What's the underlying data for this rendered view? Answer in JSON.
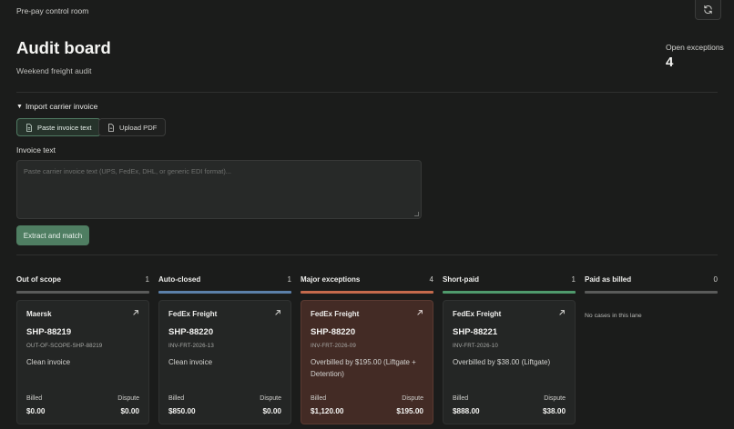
{
  "topbar": {
    "title": "Pre-pay control room",
    "refresh_icon": "refresh-icon"
  },
  "header": {
    "title": "Audit board",
    "subtitle": "Weekend freight audit",
    "exceptions_label": "Open exceptions",
    "exceptions_count": "4"
  },
  "import": {
    "toggle_label": "Import carrier invoice",
    "tabs": [
      {
        "label": "Paste invoice text",
        "icon": "file-text-icon",
        "active": true
      },
      {
        "label": "Upload PDF",
        "icon": "file-icon",
        "active": false
      }
    ],
    "field_label": "Invoice text",
    "placeholder": "Paste carrier invoice text (UPS, FedEx, DHL, or generic EDI format)...",
    "value": "",
    "submit_label": "Extract and match"
  },
  "colors": {
    "accent": "#4f7e62",
    "lane_out_of_scope": "#5a5b5a",
    "lane_auto_closed": "#5b7fa8",
    "lane_major": "#c46a4c",
    "lane_short_paid": "#4f9a6c",
    "lane_paid": "#5a5b5a",
    "major_card_bg": "#432b25"
  },
  "lanes": [
    {
      "title": "Out of scope",
      "count": "1"
    },
    {
      "title": "Auto-closed",
      "count": "1"
    },
    {
      "title": "Major exceptions",
      "count": "4"
    },
    {
      "title": "Short-paid",
      "count": "1"
    },
    {
      "title": "Paid as billed",
      "count": "0",
      "empty_text": "No cases in this lane"
    }
  ],
  "cards": [
    {
      "carrier": "Maersk",
      "shipment": "SHP-88219",
      "invoice": "OUT-OF-SCOPE-SHP-88219",
      "summary": "Clean invoice",
      "billed_label": "Billed",
      "dispute_label": "Dispute",
      "billed": "$0.00",
      "dispute": "$0.00"
    },
    {
      "carrier": "FedEx Freight",
      "shipment": "SHP-88220",
      "invoice": "INV-FRT-2026-13",
      "summary": "Clean invoice",
      "billed_label": "Billed",
      "dispute_label": "Dispute",
      "billed": "$850.00",
      "dispute": "$0.00"
    },
    {
      "carrier": "FedEx Freight",
      "shipment": "SHP-88220",
      "invoice": "INV-FRT-2026-09",
      "summary": "Overbilled by $195.00 (Liftgate + Detention)",
      "billed_label": "Billed",
      "dispute_label": "Dispute",
      "billed": "$1,120.00",
      "dispute": "$195.00"
    },
    {
      "carrier": "FedEx Freight",
      "shipment": "SHP-88221",
      "invoice": "INV-FRT-2026-10",
      "summary": "Overbilled by $38.00 (Liftgate)",
      "billed_label": "Billed",
      "dispute_label": "Dispute",
      "billed": "$888.00",
      "dispute": "$38.00"
    }
  ]
}
